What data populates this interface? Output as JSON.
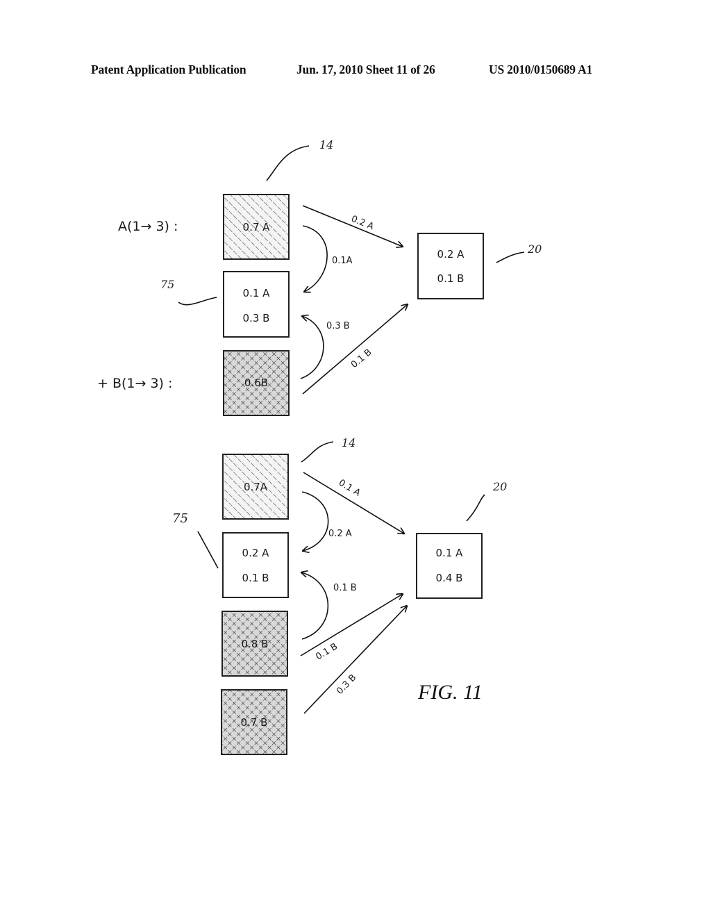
{
  "header": {
    "publication": "Patent Application Publication",
    "date_sheet": "Jun. 17, 2010  Sheet 11 of 26",
    "pub_number": "US 2010/0150689 A1"
  },
  "figure_label": "FIG. 11",
  "diagram_top": {
    "process_a_label": "A(1→ 3) :",
    "process_b_label": "+ B(1→ 3) :",
    "ref_14": "14",
    "ref_75": "75",
    "ref_20": "20",
    "source_a": {
      "text": "0.7 A",
      "fill": "diagonal-hatch"
    },
    "middle": {
      "line1": "0.1 A",
      "line2": "0.3 B"
    },
    "source_b": {
      "text": "0.6B",
      "fill": "cross-hatch"
    },
    "target": {
      "line1": "0.2 A",
      "line2": "0.1 B"
    },
    "edges": {
      "a_to_target": "0.2 A",
      "a_to_middle": "0.1A",
      "b_to_middle": "0.3 B",
      "b_to_target": "0.1 B"
    }
  },
  "diagram_bottom": {
    "ref_14": "14",
    "ref_75": "75",
    "ref_20": "20",
    "source_a": {
      "text": "0.7A",
      "fill": "diagonal-hatch"
    },
    "middle": {
      "line1": "0.2 A",
      "line2": "0.1 B"
    },
    "source_b1": {
      "text": "0.8 B",
      "fill": "cross-hatch"
    },
    "source_b2": {
      "text": "0.7 B",
      "fill": "cross-hatch"
    },
    "target": {
      "line1": "0.1 A",
      "line2": "0.4 B"
    },
    "edges": {
      "a_to_target": "0.1 A",
      "a_to_middle": "0.2 A",
      "b1_to_middle": "0.1 B",
      "b1_to_target": "0.1 B",
      "b2_to_target": "0.3 B"
    }
  }
}
